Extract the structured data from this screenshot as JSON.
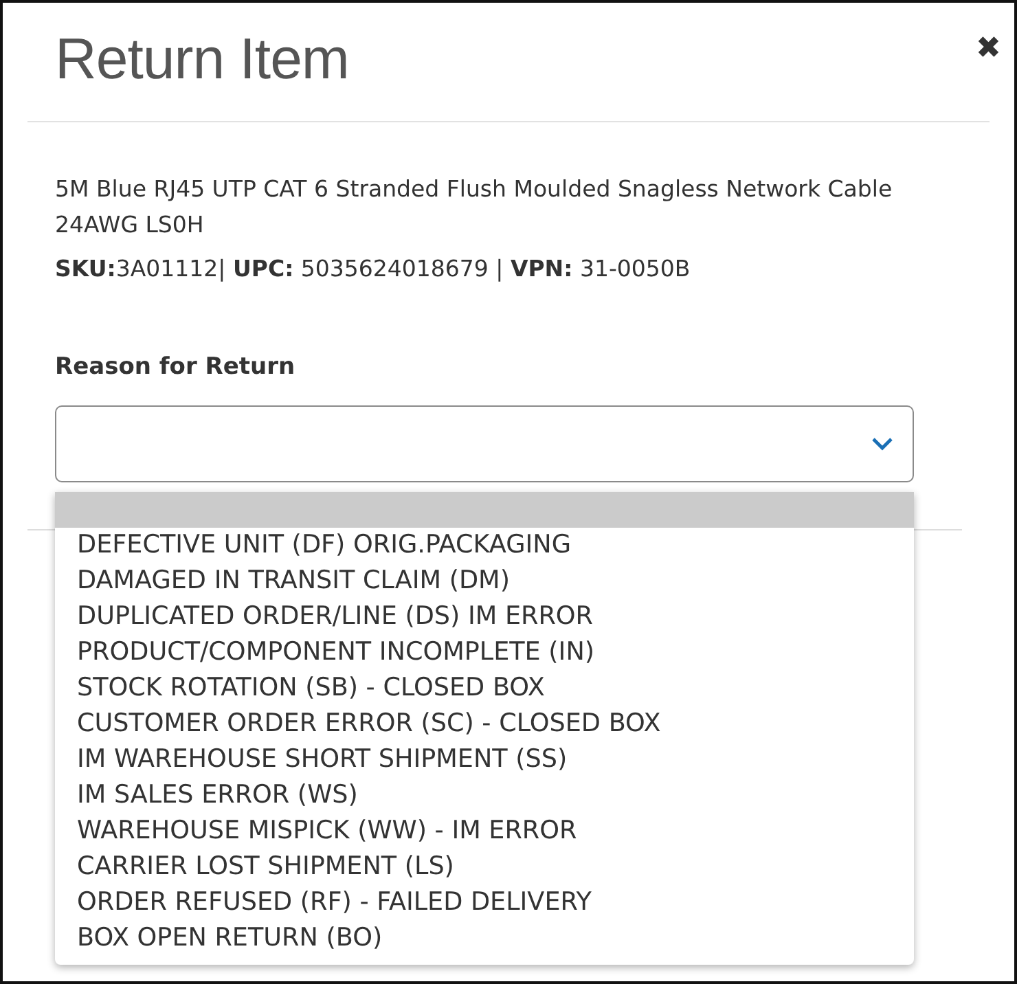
{
  "dialog": {
    "title": "Return Item",
    "close": "✖"
  },
  "product": {
    "name": "5M Blue RJ45 UTP CAT 6 Stranded Flush Moulded Snagless Network Cable 24AWG LS0H",
    "codes": "**SKU:**3A01112| **UPC:** 5035624018679 | **VPN:** 31-0050B"
  },
  "reason": {
    "label": "Reason for Return",
    "expanded": true,
    "options": [
      {
        "selected": true
      },
      {
        "label": "DEFECTIVE UNIT (DF) ORIG.PACKAGING",
        "selected": false
      },
      {
        "label": "DAMAGED IN TRANSIT CLAIM (DM)",
        "selected": false
      },
      {
        "label": "DUPLICATED ORDER/LINE (DS) IM ERROR",
        "selected": false
      },
      {
        "label": "PRODUCT/COMPONENT INCOMPLETE (IN)",
        "selected": false
      },
      {
        "label": "STOCK ROTATION (SB) - CLOSED BOX",
        "selected": false
      },
      {
        "label": "CUSTOMER ORDER ERROR (SC) - CLOSED BOX",
        "selected": false
      },
      {
        "label": "IM WAREHOUSE SHORT SHIPMENT (SS)",
        "selected": false
      },
      {
        "label": "IM SALES ERROR (WS)",
        "selected": false
      },
      {
        "label": "WAREHOUSE MISPICK (WW) - IM ERROR",
        "selected": false
      },
      {
        "label": "CARRIER LOST SHIPMENT (LS)",
        "selected": false
      },
      {
        "label": "ORDER REFUSED (RF) - FAILED DELIVERY",
        "selected": false
      },
      {
        "label": "BOX OPEN RETURN (BO)",
        "selected": false
      }
    ]
  }
}
